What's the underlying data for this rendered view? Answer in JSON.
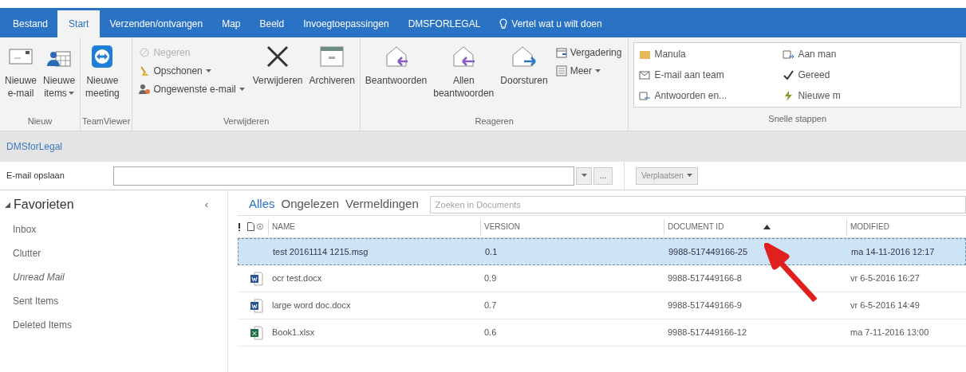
{
  "tabs": [
    {
      "label": "Bestand",
      "selected": false
    },
    {
      "label": "Start",
      "selected": true
    },
    {
      "label": "Verzenden/ontvangen",
      "selected": false
    },
    {
      "label": "Map",
      "selected": false
    },
    {
      "label": "Beeld",
      "selected": false
    },
    {
      "label": "Invoegtoepassingen",
      "selected": false
    },
    {
      "label": "DMSFORLEGAL",
      "selected": false
    }
  ],
  "tell_me": "Vertel wat u wilt doen",
  "ribbon_groups": [
    {
      "label": "Nieuw",
      "large": [
        {
          "label": "Nieuwe\ne-mail",
          "dropdown": false
        },
        {
          "label": "Nieuwe\nitems",
          "dropdown": true
        }
      ]
    },
    {
      "label": "TeamViewer",
      "large": [
        {
          "label": "Nieuwe\nmeeting",
          "dropdown": false
        }
      ]
    },
    {
      "label": "Verwijderen",
      "small": [
        {
          "label": "Negeren",
          "dropdown": false,
          "disabled": true
        },
        {
          "label": "Opschonen",
          "dropdown": true,
          "disabled": false
        },
        {
          "label": "Ongewenste e-mail",
          "dropdown": true,
          "disabled": false
        }
      ],
      "large": [
        {
          "label": "Verwijderen",
          "dropdown": false
        },
        {
          "label": "Archiveren",
          "dropdown": false
        }
      ]
    },
    {
      "label": "Reageren",
      "large": [
        {
          "label": "Beantwoorden",
          "dropdown": false
        },
        {
          "label": "Allen\nbeantwoorden",
          "dropdown": false
        },
        {
          "label": "Doorsturen",
          "dropdown": false
        }
      ],
      "small_after": [
        {
          "label": "Vergadering",
          "dropdown": false,
          "disabled": false
        },
        {
          "label": "Meer",
          "dropdown": true,
          "disabled": false
        }
      ]
    }
  ],
  "quick_steps": {
    "label": "Snelle stappen",
    "items": [
      "Manula",
      "Aan man",
      "E-mail aan team",
      "Gereed",
      "Antwoorden en...",
      "Nieuwe m"
    ]
  },
  "addin_bar": {
    "title": "DMSforLegal",
    "save_label": "E-mail opslaan",
    "more_button": "...",
    "move_button": "Verplaatsen"
  },
  "sidebar": {
    "section": "Favorieten",
    "expanded": true,
    "collapse": "‹",
    "items": [
      {
        "label": "Inbox",
        "italic": false
      },
      {
        "label": "Clutter",
        "italic": false
      },
      {
        "label": "Unread Mail",
        "italic": true
      },
      {
        "label": "Sent Items",
        "italic": false
      },
      {
        "label": "Deleted Items",
        "italic": false
      }
    ]
  },
  "filters": [
    {
      "label": "Alles",
      "selected": true
    },
    {
      "label": "Ongelezen",
      "selected": false
    },
    {
      "label": "Vermeldingen",
      "selected": false
    }
  ],
  "search": {
    "placeholder": "Zoeken in Documents"
  },
  "table": {
    "columns": [
      {
        "label": "NAME",
        "sorted": false
      },
      {
        "label": "VERSION",
        "sorted": false
      },
      {
        "label": "DOCUMENT ID",
        "sorted": true
      },
      {
        "label": "MODIFIED",
        "sorted": false
      }
    ],
    "rows": [
      {
        "kind": "mail",
        "selected": true,
        "cells": [
          "test 20161114 1215.msg",
          "0.1",
          "9988-517449166-25",
          "ma 14-11-2016 12:17"
        ]
      },
      {
        "kind": "word",
        "selected": false,
        "cells": [
          "ocr test.docx",
          "0.9",
          "9988-517449166-8",
          "vr 6-5-2016 16:27"
        ]
      },
      {
        "kind": "word",
        "selected": false,
        "cells": [
          "large word doc.docx",
          "0.7",
          "9988-517449166-9",
          "vr 6-5-2016 14:49"
        ]
      },
      {
        "kind": "excel",
        "selected": false,
        "cells": [
          "Book1.xlsx",
          "0.6",
          "9988-517449166-12",
          "ma 7-11-2016 13:00"
        ]
      }
    ]
  }
}
